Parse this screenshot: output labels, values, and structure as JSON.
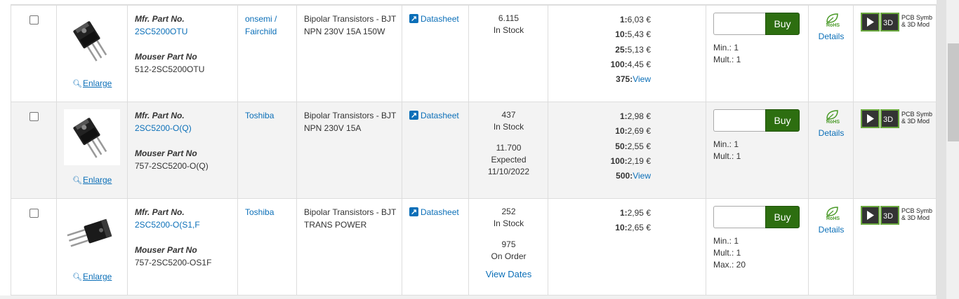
{
  "rows": [
    {
      "mfr_part_label": "Mfr. Part No.",
      "mfr_part_no": "2SC5200OTU",
      "mouser_part_label": "Mouser Part No",
      "mouser_part_no": "512-2SC5200OTU",
      "enlarge": "Enlarge",
      "manufacturer": "onsemi / Fairchild",
      "description": "Bipolar Transistors - BJT NPN 230V 15A 150W",
      "datasheet": "Datasheet",
      "stock_qty": "6.115",
      "stock_label": "In Stock",
      "expected_qty": "",
      "expected_label": "",
      "expected_date": "",
      "view_dates": "",
      "prices": [
        {
          "qty": "1:",
          "price": "6,03 €",
          "is_view": false
        },
        {
          "qty": "10:",
          "price": "5,43 €",
          "is_view": false
        },
        {
          "qty": "25:",
          "price": "5,13 €",
          "is_view": false
        },
        {
          "qty": "100:",
          "price": "4,45 €",
          "is_view": false
        },
        {
          "qty": "375:",
          "price": "View",
          "is_view": true
        }
      ],
      "buy": "Buy",
      "min": "Min.: 1",
      "mult": "Mult.: 1",
      "max": "",
      "rohs": "RoHS",
      "details": "Details",
      "ecad_text_1": "PCB Symb",
      "ecad_text_2": "& 3D Mod"
    },
    {
      "mfr_part_label": "Mfr. Part No.",
      "mfr_part_no": "2SC5200-O(Q)",
      "mouser_part_label": "Mouser Part No",
      "mouser_part_no": "757-2SC5200-O(Q)",
      "enlarge": "Enlarge",
      "manufacturer": "Toshiba",
      "description": "Bipolar Transistors - BJT NPN 230V 15A",
      "datasheet": "Datasheet",
      "stock_qty": "437",
      "stock_label": "In Stock",
      "expected_qty": "11.700",
      "expected_label": "Expected",
      "expected_date": "11/10/2022",
      "view_dates": "",
      "prices": [
        {
          "qty": "1:",
          "price": "2,98 €",
          "is_view": false
        },
        {
          "qty": "10:",
          "price": "2,69 €",
          "is_view": false
        },
        {
          "qty": "50:",
          "price": "2,55 €",
          "is_view": false
        },
        {
          "qty": "100:",
          "price": "2,19 €",
          "is_view": false
        },
        {
          "qty": "500:",
          "price": "View",
          "is_view": true
        }
      ],
      "buy": "Buy",
      "min": "Min.: 1",
      "mult": "Mult.: 1",
      "max": "",
      "rohs": "RoHS",
      "details": "Details",
      "ecad_text_1": "PCB Symb",
      "ecad_text_2": "& 3D Mod"
    },
    {
      "mfr_part_label": "Mfr. Part No.",
      "mfr_part_no": "2SC5200-O(S1,F",
      "mouser_part_label": "Mouser Part No",
      "mouser_part_no": "757-2SC5200-OS1F",
      "enlarge": "Enlarge",
      "manufacturer": "Toshiba",
      "description": "Bipolar Transistors - BJT TRANS POWER",
      "datasheet": "Datasheet",
      "stock_qty": "252",
      "stock_label": "In Stock",
      "expected_qty": "975",
      "expected_label": "On Order",
      "expected_date": "",
      "view_dates": "View Dates",
      "prices": [
        {
          "qty": "1:",
          "price": "2,95 €",
          "is_view": false
        },
        {
          "qty": "10:",
          "price": "2,65 €",
          "is_view": false
        }
      ],
      "buy": "Buy",
      "min": "Min.: 1",
      "mult": "Mult.: 1",
      "max": "Max.: 20",
      "rohs": "RoHS",
      "details": "Details",
      "ecad_text_1": "PCB Symb",
      "ecad_text_2": "& 3D Mod"
    }
  ],
  "icons": {
    "checkbox": "checkbox-icon",
    "magnifier": "magnifier-icon",
    "datasheet": "external-link-icon",
    "rohs": "rohs-leaf-icon",
    "ecad": "ecad-model-icon"
  },
  "colors": {
    "link": "#0b6fb8",
    "buy_button": "#2d6e10",
    "alt_row": "#f3f3f3",
    "rohs_green": "#4a9a28"
  }
}
